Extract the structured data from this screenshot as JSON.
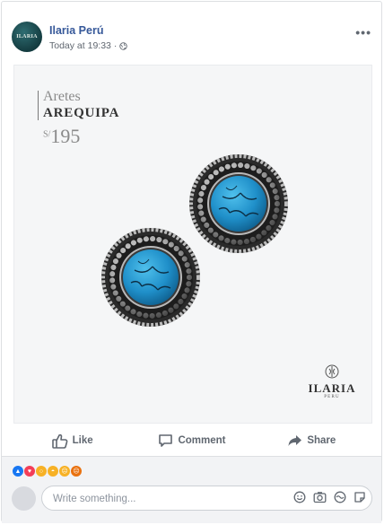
{
  "post": {
    "page_name": "Ilaria Perú",
    "timestamp": "Today at 19:33",
    "separator": "·",
    "avatar_text": "ILARIA",
    "more_label": "•••",
    "privacy_icon": "globe-icon"
  },
  "photo": {
    "line1": "Aretes",
    "line2": "AREQUIPA",
    "currency": "S/",
    "price": "195",
    "logo_word": "ILARIA",
    "logo_sub": "PERU"
  },
  "actions": [
    {
      "label": "Like",
      "icon": "thumbs-up-icon"
    },
    {
      "label": "Comment",
      "icon": "comment-icon"
    },
    {
      "label": "Share",
      "icon": "share-icon"
    }
  ],
  "reactions": [
    "like",
    "love",
    "wow",
    "haha",
    "sad",
    "angry"
  ],
  "composer": {
    "placeholder": "Write something...",
    "icons": [
      "emoji-icon",
      "camera-icon",
      "gif-icon",
      "sticker-icon"
    ]
  },
  "colors": {
    "link": "#365899",
    "muted": "#606770",
    "turquoise": "#1f8fc9",
    "footer_bg": "#f2f3f5"
  }
}
